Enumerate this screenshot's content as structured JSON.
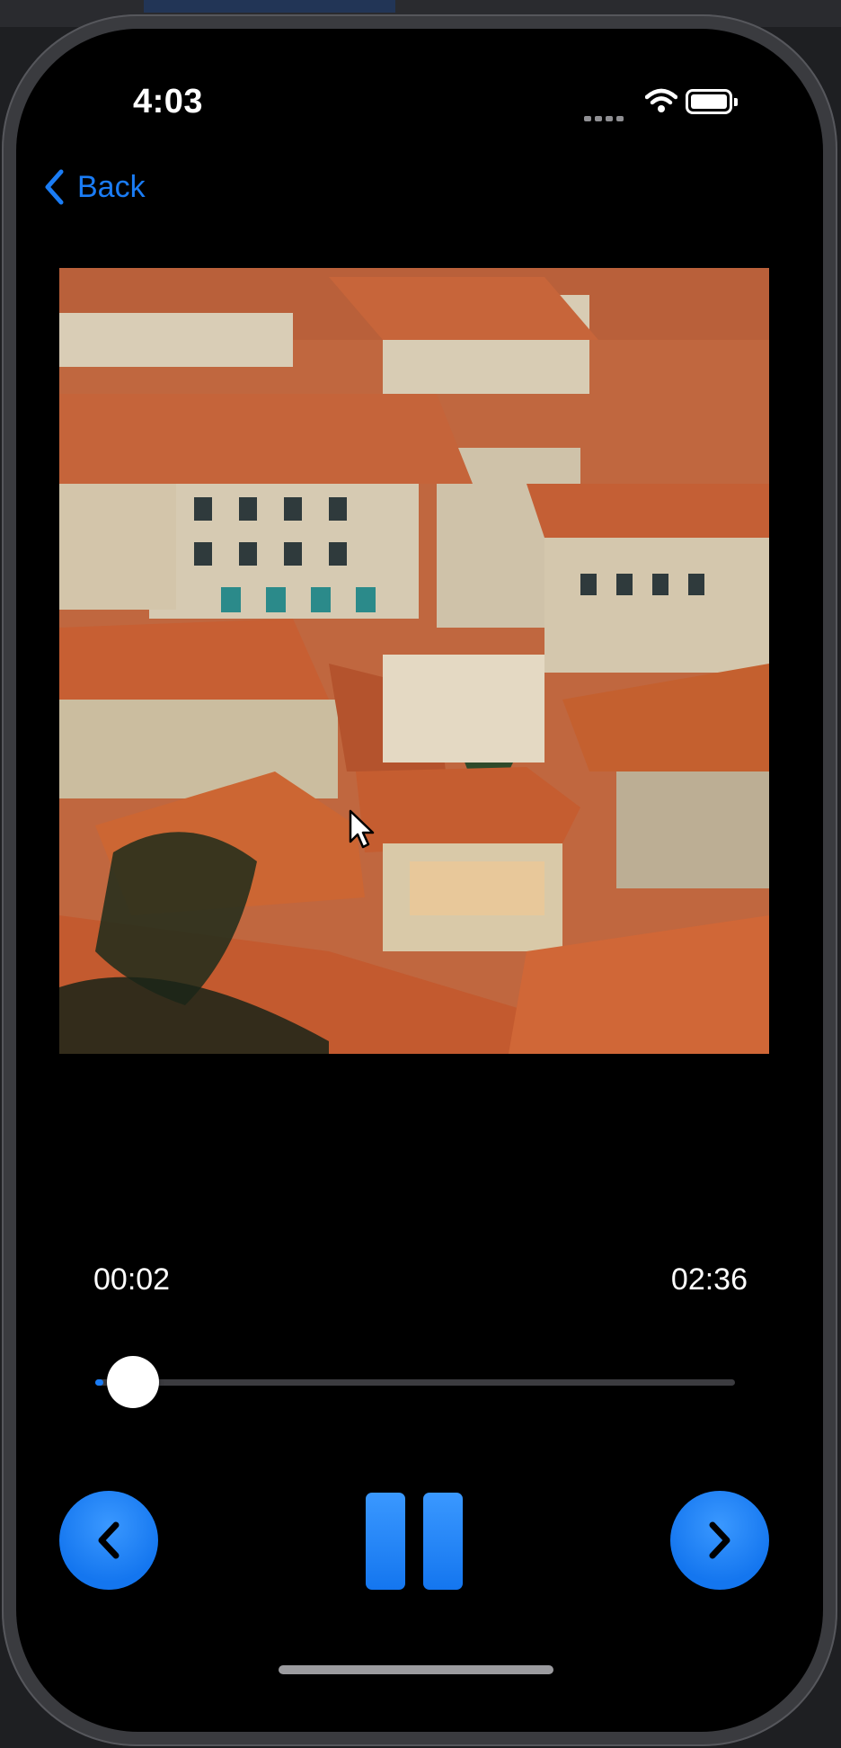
{
  "status_bar": {
    "time": "4:03"
  },
  "nav": {
    "back_label": "Back"
  },
  "player": {
    "current_time": "00:02",
    "total_time": "02:36",
    "progress_fraction": 0.013,
    "state": "playing"
  },
  "artwork": {
    "icon": "album-artwork-image"
  },
  "colors": {
    "accent": "#1a7cf5",
    "background": "#000000",
    "roof": "#c86a3e",
    "wall": "#d8cdb8"
  },
  "icons": {
    "back": "chevron-left-icon",
    "prev": "chevron-left-icon",
    "next": "chevron-right-icon",
    "pause": "pause-icon",
    "wifi": "wifi-icon",
    "battery": "battery-icon",
    "signal": "signal-icon"
  }
}
